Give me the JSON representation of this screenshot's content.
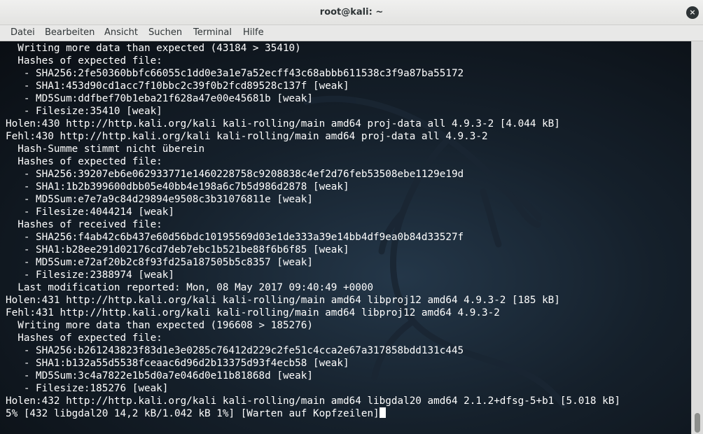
{
  "window": {
    "title": "root@kali: ~",
    "close_icon": "×"
  },
  "menu": [
    "Datei",
    "Bearbeiten",
    "Ansicht",
    "Suchen",
    "Terminal",
    "Hilfe"
  ],
  "terminal": {
    "lines": [
      "  Writing more data than expected (43184 > 35410)",
      "  Hashes of expected file:",
      "   - SHA256:2fe50360bbfc66055c1dd0e3a1e7a52ecff43c68abbb611538c3f9a87ba55172",
      "   - SHA1:453d90cd1acc7f10bbc2c39f0b2fcd89528c137f [weak]",
      "   - MD5Sum:ddfbef70b1eba21f628a47e00e45681b [weak]",
      "   - Filesize:35410 [weak]",
      "Holen:430 http://http.kali.org/kali kali-rolling/main amd64 proj-data all 4.9.3-2 [4.044 kB]",
      "Fehl:430 http://http.kali.org/kali kali-rolling/main amd64 proj-data all 4.9.3-2",
      "  Hash-Summe stimmt nicht überein",
      "  Hashes of expected file:",
      "   - SHA256:39207eb6e062933771e1460228758c9208838c4ef2d76feb53508ebe1129e19d",
      "   - SHA1:1b2b399600dbb05e40bb4e198a6c7b5d986d2878 [weak]",
      "   - MD5Sum:e7e7a9c84d29894e9508c3b31076811e [weak]",
      "   - Filesize:4044214 [weak]",
      "  Hashes of received file:",
      "   - SHA256:f4ab42c6b437e60d56bdc10195569d03e1de333a39e14bb4df9ea0b84d33527f",
      "   - SHA1:b28ee291d02176cd7deb7ebc1b521be88f6b6f85 [weak]",
      "   - MD5Sum:e72af20b2c8f93fd25a187505b5c8357 [weak]",
      "   - Filesize:2388974 [weak]",
      "  Last modification reported: Mon, 08 May 2017 09:40:49 +0000",
      "Holen:431 http://http.kali.org/kali kali-rolling/main amd64 libproj12 amd64 4.9.3-2 [185 kB]",
      "Fehl:431 http://http.kali.org/kali kali-rolling/main amd64 libproj12 amd64 4.9.3-2",
      "  Writing more data than expected (196608 > 185276)",
      "  Hashes of expected file:",
      "   - SHA256:b261243823f83d1e3e0285c76412d229c2fe51c4cca2e67a317858bdd131c445",
      "   - SHA1:b132a55d5538fceaac6d96d2b13375d93f4ecb58 [weak]",
      "   - MD5Sum:3c4a7822e1b5d0a7e046d0e11b81868d [weak]",
      "   - Filesize:185276 [weak]",
      "Holen:432 http://http.kali.org/kali kali-rolling/main amd64 libgdal20 amd64 2.1.2+dfsg-5+b1 [5.018 kB]",
      "5% [432 libgdal20 14,2 kB/1.042 kB 1%] [Warten auf Kopfzeilen]"
    ]
  },
  "scrollbar": {
    "position_fraction": 1.0
  },
  "icons": {
    "close": "close-icon",
    "background": "kali-dragon-icon"
  },
  "colors": {
    "terminal_text": "#ffffff",
    "terminal_background": "#0f1822",
    "titlebar": "#e8e8e7"
  }
}
